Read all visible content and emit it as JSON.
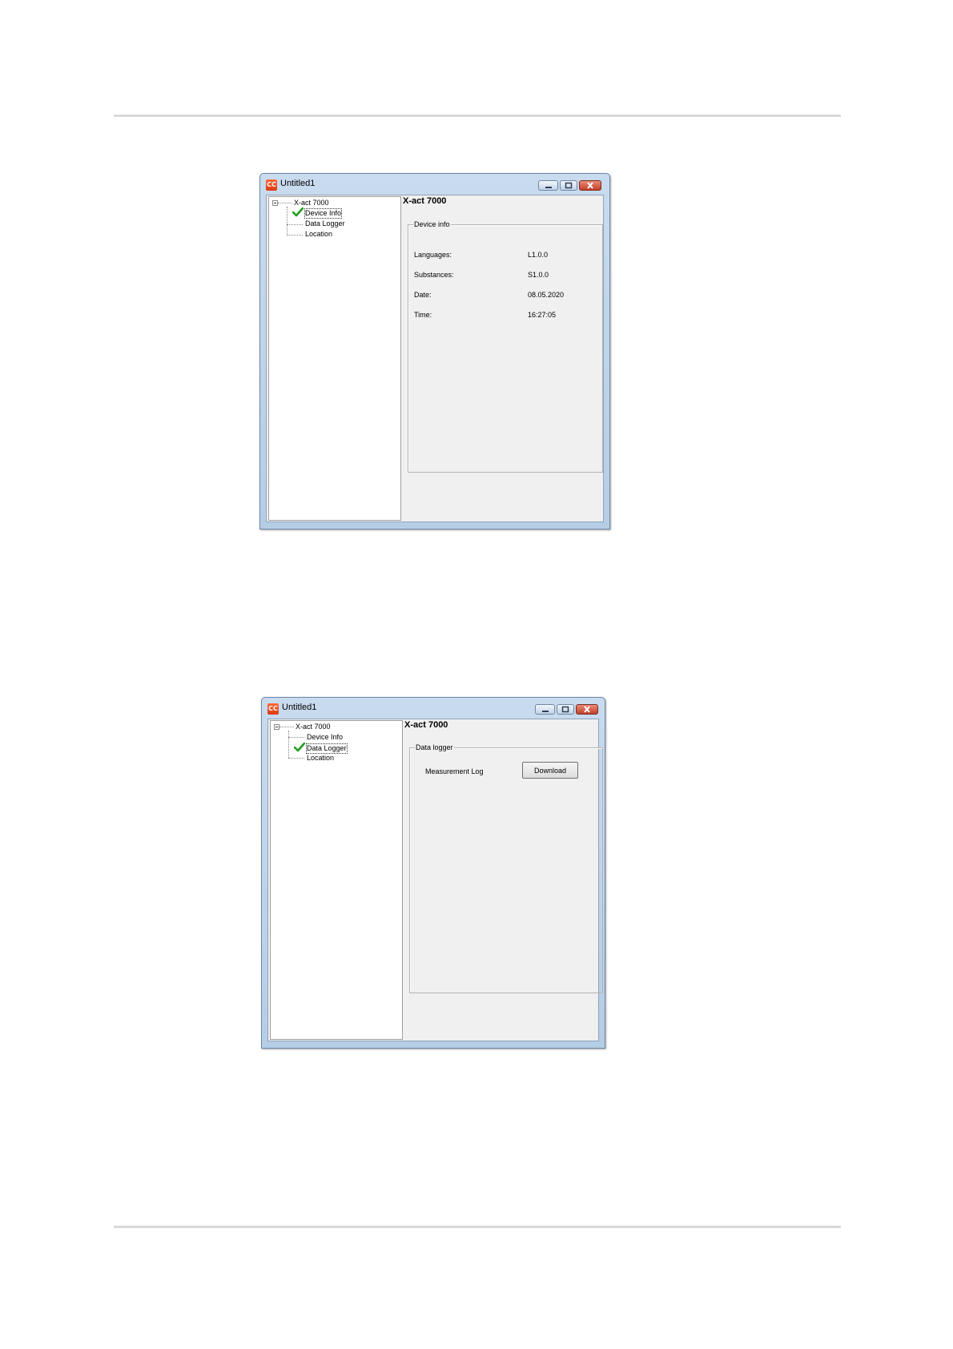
{
  "windows": [
    {
      "title": "Untitled1",
      "app_icon": "CC",
      "tree": {
        "root": "X-act 7000",
        "items": [
          "Device Info",
          "Data Logger",
          "Location"
        ],
        "selected_index": 0
      },
      "content_title": "X-act 7000",
      "group": {
        "legend": "Device info",
        "rows": [
          {
            "label": "Languages:",
            "value": "L1.0.0"
          },
          {
            "label": "Substances:",
            "value": "S1.0.0"
          },
          {
            "label": "Date:",
            "value": "08.05.2020"
          },
          {
            "label": "Time:",
            "value": "16:27:05"
          }
        ]
      }
    },
    {
      "title": "Untitled1",
      "app_icon": "CC",
      "tree": {
        "root": "X-act 7000",
        "items": [
          "Device Info",
          "Data Logger",
          "Location"
        ],
        "selected_index": 1
      },
      "content_title": "X-act 7000",
      "group": {
        "legend": "Data logger",
        "row_label": "Measurement Log",
        "button_label": "Download"
      }
    }
  ],
  "icons": {
    "app": "app-logo-icon",
    "minimize": "minimize-icon",
    "maximize": "maximize-icon",
    "close": "close-icon",
    "expander": "tree-collapse-icon",
    "selected": "checkmark-icon"
  },
  "colors": {
    "titlebar": "#c9dbee",
    "checkmark": "#1e9e1e",
    "close_button": "#c2402b"
  }
}
